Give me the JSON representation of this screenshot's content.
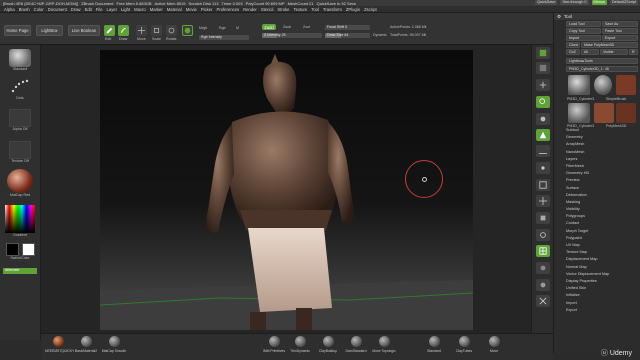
{
  "window": {
    "title": "[Brush 4R8 (DE4C+MP-GRP-DOH-MGM)]",
    "doc": "ZBrush Document",
    "mem_free": "Free Mem 5.883GB",
    "mem_active": "Active Mem 8519",
    "scratch": "Scratch Disk 113",
    "timer": "Timer 0.003",
    "polycount": "PolyCount 99.699 MP",
    "meshcount": "MeshCount 21",
    "quicksave": "QuickSave In 52 Secs"
  },
  "menubar": {
    "items": [
      "Alpha",
      "Brush",
      "Color",
      "Document",
      "Draw",
      "Edit",
      "File",
      "Layer",
      "Light",
      "Macro",
      "Marker",
      "Material",
      "Movie",
      "Picker",
      "Preferences",
      "Render",
      "Stencil",
      "Stroke",
      "Texture",
      "Tool",
      "Transform",
      "ZPlugin",
      "Zscript"
    ],
    "quicksave_label": "QuickSave",
    "seethrough_label": "See-through 0",
    "menus_label": "Menus",
    "default_script_label": "DefaultZScript"
  },
  "toolbar": {
    "home_page": "Home Page",
    "lightbox": "LightBox",
    "live_boolean": "Live Boolean",
    "edit": "Edit",
    "draw": "Draw",
    "move": "Move",
    "scale": "Scale",
    "rotate": "Rotate",
    "mrgb": "Mrgb",
    "rgb": "Rgb",
    "m": "M",
    "zadd": "Zadd",
    "zsub": "Zsub",
    "zcut": "Zcut",
    "focal_shift": "Focal Shift 0",
    "draw_size": "Draw Size 64",
    "dynamic": "Dynamic",
    "active_points": "ActivePoints: 2.388 Mil",
    "total_points": "TotalPoints: 96.097 Mil",
    "rgb_intensity": "Rgb Intensity",
    "z_intensity": "Z Intensity 25"
  },
  "leftpanel": {
    "brush_label": "Standard",
    "stroke_label": "Dots",
    "alpha_label": "Alpha Off",
    "texture_label": "Texture Off",
    "material_label": "MatCap Red",
    "gradient_label": "Gradient",
    "switch_color": "SwitchColor",
    "alternate": "Alternate"
  },
  "rightshelf": {
    "icons": [
      "BPR",
      "SPix 3",
      "Scroll",
      "Zoom",
      "Actual",
      "AAHalf",
      "Persp",
      "Floor",
      "Local",
      "Frame",
      "Move",
      "Scale",
      "Rotate",
      "PolyF",
      "Transp",
      "Solo",
      "Xpose"
    ]
  },
  "tray": {
    "title": "Tool",
    "load_tool": "Load Tool",
    "save_as": "Save As",
    "copy_tool": "Copy Tool",
    "paste_tool": "Paste Tool",
    "import": "Import",
    "export": "Export",
    "clone": "Clone",
    "make_polymesh": "Make PolyMesh3D",
    "goz": "GoZ",
    "all": "All",
    "visible": "Visible",
    "r": "R",
    "lightbox_tools": "Lightbox▸Tools",
    "current_tool": "PM3D_Cylinder3D_1: 48",
    "thumb_labels": [
      "PM3D_Cylinder3",
      "SimpleBrush",
      "PM3D_Cylinder3",
      "PolyMesh3D"
    ],
    "sections": [
      "Subtool",
      "Geometry",
      "ArrayMesh",
      "NanoMesh",
      "Layers",
      "FiberMesh",
      "Geometry HD",
      "Preview",
      "Surface",
      "Deformation",
      "Masking",
      "Visibility",
      "Polygroups",
      "Contact",
      "Morph Target",
      "Polypaint",
      "UV Map",
      "Texture Map",
      "Displacement Map",
      "Normal Map",
      "Vector Displacement Map",
      "Display Properties",
      "Unified Skin",
      "Initialize",
      "Import",
      "Export"
    ]
  },
  "bottombar": {
    "brushes": [
      "IMM Primitives",
      "TrimDynamic",
      "ClayBuildup",
      "DamStandard",
      "Move Topologic",
      "Standard",
      "ClayTubes",
      "Move"
    ],
    "left_brushes": [
      "NEEEMSTQUICKY",
      "BasicMaterial2",
      "MatCap Smooth"
    ]
  },
  "watermark": {
    "text": "Udemy"
  },
  "colors": {
    "accent_green": "#5fa23a",
    "cursor_red": "#c73a3a"
  }
}
